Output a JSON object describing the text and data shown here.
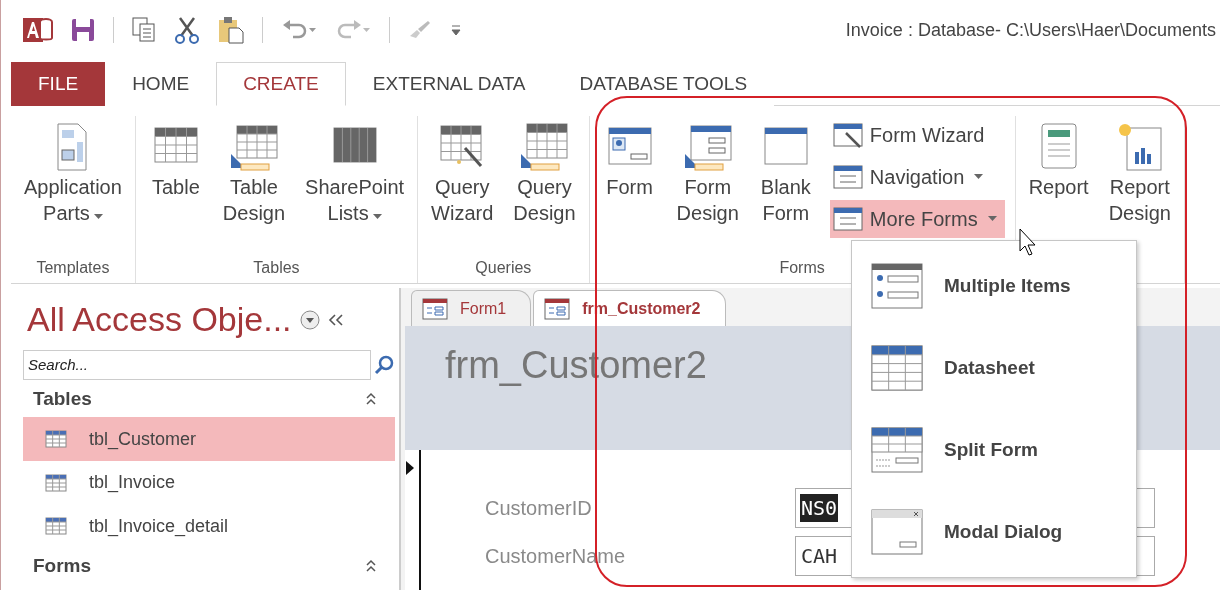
{
  "title_bar": {
    "title": "Invoice : Database- C:\\Users\\Haer\\Documents"
  },
  "ribbon_tabs": [
    {
      "label": "FILE",
      "kind": "file",
      "selected": false
    },
    {
      "label": "HOME",
      "kind": "tab",
      "selected": false
    },
    {
      "label": "CREATE",
      "kind": "tab",
      "selected": true
    },
    {
      "label": "EXTERNAL DATA",
      "kind": "tab",
      "selected": false
    },
    {
      "label": "DATABASE TOOLS",
      "kind": "tab",
      "selected": false
    }
  ],
  "ribbon_groups": [
    {
      "label": "Templates",
      "buttons": [
        {
          "lines": [
            "Application",
            "Parts"
          ],
          "dropdown": true
        }
      ]
    },
    {
      "label": "Tables",
      "buttons": [
        {
          "lines": [
            "Table"
          ],
          "dropdown": false
        },
        {
          "lines": [
            "Table",
            "Design"
          ],
          "dropdown": false
        },
        {
          "lines": [
            "SharePoint",
            "Lists"
          ],
          "dropdown": true
        }
      ]
    },
    {
      "label": "Queries",
      "buttons": [
        {
          "lines": [
            "Query",
            "Wizard"
          ],
          "dropdown": false
        },
        {
          "lines": [
            "Query",
            "Design"
          ],
          "dropdown": false
        }
      ]
    },
    {
      "label": "Forms",
      "buttons": [
        {
          "lines": [
            "Form"
          ],
          "dropdown": false
        },
        {
          "lines": [
            "Form",
            "Design"
          ],
          "dropdown": false
        },
        {
          "lines": [
            "Blank",
            "Form"
          ],
          "dropdown": false
        }
      ],
      "small_buttons": [
        {
          "label": "Form Wizard",
          "dropdown": false,
          "selected": false
        },
        {
          "label": "Navigation",
          "dropdown": true,
          "selected": false
        },
        {
          "label": "More Forms",
          "dropdown": true,
          "selected": true
        }
      ]
    },
    {
      "buttons": [
        {
          "lines": [
            "Report"
          ],
          "dropdown": false
        },
        {
          "lines": [
            "Report",
            "Design"
          ],
          "dropdown": false
        }
      ]
    }
  ],
  "dropdown_menu": {
    "items": [
      {
        "label": "Multiple Items"
      },
      {
        "label": "Datasheet"
      },
      {
        "label": "Split Form"
      },
      {
        "label": "Modal Dialog"
      }
    ]
  },
  "nav_pane": {
    "title": "All Access Obje...",
    "search": {
      "placeholder": "Search..."
    },
    "sections": [
      {
        "label": "Tables",
        "items": [
          {
            "label": "tbl_Customer",
            "selected": true
          },
          {
            "label": "tbl_Invoice",
            "selected": false
          },
          {
            "label": "tbl_Invoice_detail",
            "selected": false
          }
        ]
      },
      {
        "label": "Forms"
      }
    ]
  },
  "document": {
    "tabs": [
      {
        "label": "Form1",
        "selected": false
      },
      {
        "label": "frm_Customer2",
        "selected": true
      }
    ],
    "form": {
      "title": "frm_Customer2",
      "fields": [
        {
          "label": "CustomerID",
          "value": "NS0",
          "selected": true
        },
        {
          "label": "CustomerName",
          "value": "CAH",
          "selected": false
        }
      ]
    }
  }
}
